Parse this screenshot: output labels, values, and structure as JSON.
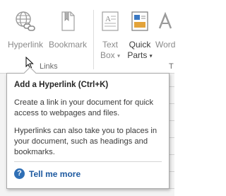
{
  "ribbon": {
    "hyperlink": {
      "label": "Hyperlink"
    },
    "bookmark": {
      "label": "Bookmark"
    },
    "textbox": {
      "line1": "Text",
      "line2": "Box",
      "caret": "▾"
    },
    "quickparts": {
      "line1": "Quick",
      "line2": "Parts",
      "caret": "▾"
    },
    "wordart": {
      "line1": "Word"
    },
    "links_group_label": "Links",
    "text_group_label": "T"
  },
  "tooltip": {
    "title": "Add a Hyperlink (Ctrl+K)",
    "para1": "Create a link in your document for quick access to webpages and files.",
    "para2": "Hyperlinks can also take you to places in your document, such as headings and bookmarks.",
    "more_label": "Tell me more",
    "help_glyph": "?"
  },
  "icons": [
    "hyperlink-icon",
    "bookmark-icon",
    "textbox-icon",
    "quickparts-icon",
    "wordart-icon",
    "help-icon",
    "mouse-cursor-icon"
  ]
}
